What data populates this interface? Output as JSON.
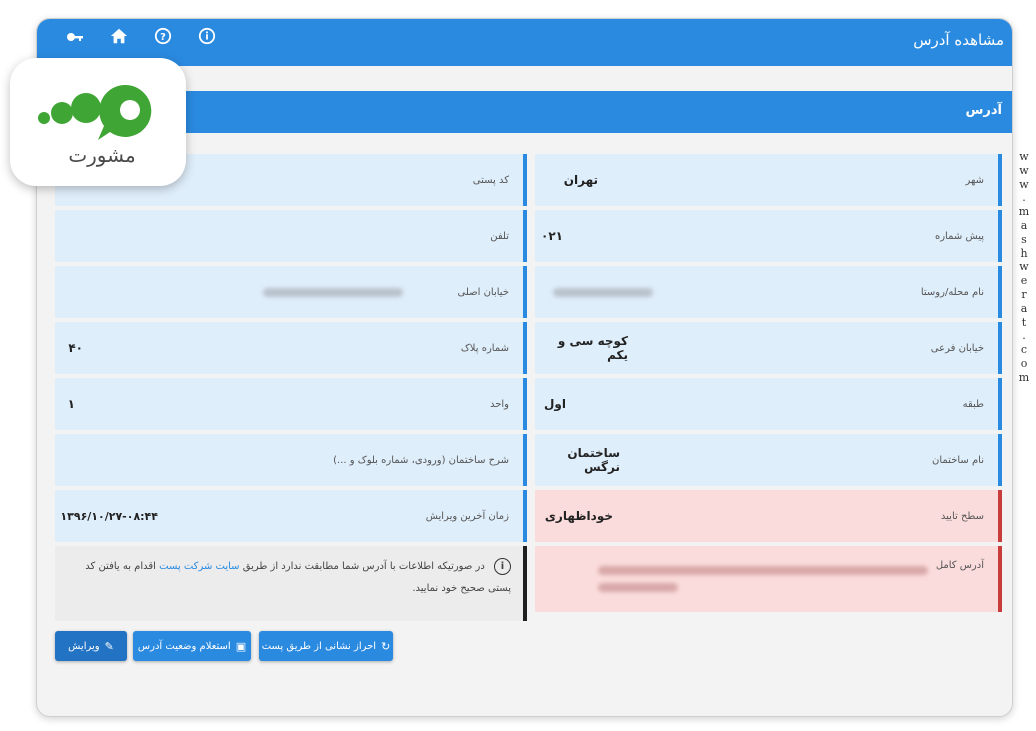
{
  "window": {
    "title": "مشاهده آدرس"
  },
  "toolbar": {
    "icons": [
      "key-icon",
      "home-icon",
      "help-icon",
      "info-icon"
    ]
  },
  "section": {
    "title": "آدرس"
  },
  "fields": {
    "city": {
      "label": "شهر",
      "value": "تهران"
    },
    "phone_prefix": {
      "label": "پیش شماره",
      "value": "۰۲۱"
    },
    "locality": {
      "label": "نام محله/روستا"
    },
    "side_street": {
      "label": "خیابان فرعی",
      "value": "کوچه سی و یکم"
    },
    "floor": {
      "label": "طبقه",
      "value": "اول"
    },
    "building_name": {
      "label": "نام ساختمان",
      "value": "ساختمان نرگس"
    },
    "verification_level": {
      "label": "سطح تایید",
      "value": "خوداظهاری"
    },
    "full_address": {
      "label": "آدرس کامل"
    },
    "postal_code": {
      "label": "کد پستی"
    },
    "telephone": {
      "label": "تلفن"
    },
    "main_street": {
      "label": "خیابان اصلی"
    },
    "plate_number": {
      "label": "شماره پلاک",
      "value": "۴۰"
    },
    "unit": {
      "label": "واحد",
      "value": "۱"
    },
    "building_description": {
      "label": "شرح ساختمان (ورودی، شماره بلوک و ...)"
    },
    "edit_time": {
      "label": "زمان آخرین ویرایش",
      "value": "۱۳۹۶/۱۰/۲۷-۰۸:۴۴"
    }
  },
  "notice": {
    "text_before": "در صورتیکه اطلاعات با آدرس شما مطابقت ندارد از طریق",
    "link": "سایت شرکت پست",
    "text_after": "اقدام به یافتن کد پستی صحیح خود نمایید."
  },
  "buttons": {
    "edit": "ویرایش",
    "confirm_status": "استعلام وضعیت آدرس",
    "verify_via_post": "احراز نشانی از طریق پست"
  },
  "logo": {
    "text": "مشورت"
  },
  "watermark": {
    "text": "www.mashwerat.com"
  },
  "colors": {
    "primary": "#2a8ae0",
    "cell_bg": "#dfeefb",
    "warning_bg": "#fbdcdc",
    "warning_border": "#c93c3c"
  }
}
